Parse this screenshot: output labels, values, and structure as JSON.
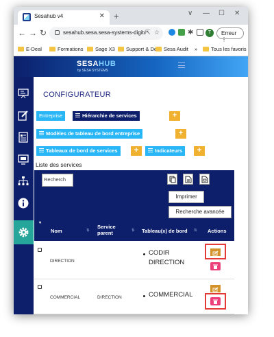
{
  "browser": {
    "tab_title": "Sesahub v4",
    "url": "sesahub.sesa.sesa-systems-digital.co...",
    "profile_initial": "T",
    "error_label": "Erreur",
    "bookmarks": [
      "E-Deal",
      "Formations",
      "Sage X3",
      "Support & Dev",
      "Sesa Audit",
      "Tous les favoris"
    ],
    "bookmarks_overflow": "»"
  },
  "app": {
    "brand_part1": "SESA",
    "brand_part2": "HUB",
    "brand_sub": "by SESA SYSTEMS",
    "page_title": "CONFIGURATEUR",
    "buttons": {
      "entreprise": "Entreprise",
      "hierarchie": "Hiérarchie de services",
      "modeles": "Modèles de tableau de bord entreprise",
      "tableaux": "Tableaux de bord de services",
      "indicateurs": "Indicateurs",
      "plus": "+"
    },
    "section_label": "Liste des services",
    "search_placeholder": "Recherch",
    "print_label": "Imprimer",
    "advanced_search_label": "Recherche avancée",
    "table": {
      "headers": [
        "Nom",
        "Service parent",
        "Tableau(x) de bord",
        "Actions"
      ],
      "rows": [
        {
          "nom": "DIRECTION",
          "parent": "",
          "tableaux_line1": "CODIR",
          "tableaux_line2": "DIRECTION"
        },
        {
          "nom": "COMMERCIAL",
          "parent": "DIRECTION",
          "tableaux_line1": "COMMERCIAL",
          "tableaux_line2": ""
        }
      ]
    },
    "sidebar_icons": [
      "presentation-icon",
      "edit-document-icon",
      "report-icon",
      "monitor-icon",
      "hierarchy-icon",
      "info-icon",
      "settings-icon"
    ]
  },
  "colors": {
    "navy": "#0d1f6b",
    "cyan": "#29b6f6",
    "orange": "#f0b030",
    "teal": "#26a69a",
    "pink": "#ec407a",
    "highlight": "#e53935"
  }
}
